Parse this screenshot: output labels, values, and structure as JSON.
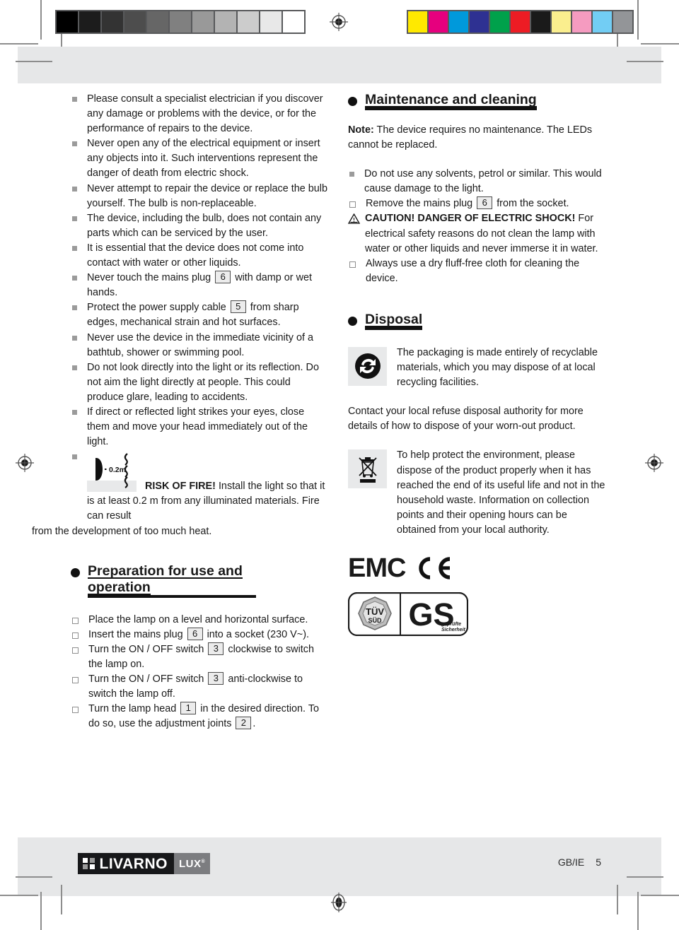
{
  "print_marks": {
    "grayscale_wedge": [
      "#000000",
      "#1c1c1c",
      "#333333",
      "#4d4d4d",
      "#666666",
      "#808080",
      "#999999",
      "#b3b3b3",
      "#cccccc",
      "#e8e8e8",
      "#ffffff"
    ],
    "color_bar": [
      "#ffe900",
      "#e6007e",
      "#0099db",
      "#2e3192",
      "#00a14b",
      "#ed1c24",
      "#1a1a1a",
      "#faee8e",
      "#f59bc0",
      "#72cdf4",
      "#939598"
    ],
    "registration_icon": "registration-target-icon"
  },
  "left_column": {
    "safety_bullets": [
      "Please consult a specialist electrician if you discover any damage or problems with the device, or for the performance of repairs to the device.",
      "Never open any of the electrical equipment or insert any objects into it. Such interventions represent the danger of death from electric shock.",
      "Never attempt to repair the device or replace the bulb yourself. The bulb is non-replaceable.",
      "The device, including the bulb, does not contain any parts which can be serviced by the user.",
      "It is essential that the device does not come into contact with water or other liquids."
    ],
    "plug_bullet": {
      "before": "Never touch the mains plug",
      "ref": "6",
      "after": "with damp or wet hands."
    },
    "cable_bullet": {
      "before": "Protect the power supply cable",
      "ref": "5",
      "after": "from sharp edges, mechanical strain and hot surfaces."
    },
    "safety_bullets_2": [
      "Never use the device in the immediate vicinity of a bathtub, shower or swimming pool.",
      "Do not look directly into the light or its reflection. Do not aim the light directly at people. This could produce glare, leading to accidents.",
      "If direct or reflected light strikes your eyes, close them and move your head immediately out of the light."
    ],
    "fire_warning": {
      "icon": "minimum-distance-0.2m-icon",
      "icon_label": "---0.2m",
      "title": "RISK OF FIRE!",
      "body": "Install the light so that it is at least 0.2 m from any illuminated materials. Fire can result",
      "tail": "from the development of too much heat."
    },
    "preparation": {
      "heading": "Preparation for use and operation",
      "steps": [
        {
          "before": "Place the lamp on a level and horizontal surface.",
          "ref": "",
          "after": ""
        },
        {
          "before": "Insert the mains plug",
          "ref": "6",
          "after": "into a socket (230 V~)."
        },
        {
          "before": "Turn the ON / OFF switch",
          "ref": "3",
          "after": "clockwise to switch the lamp on."
        },
        {
          "before": "Turn the ON / OFF switch",
          "ref": "3",
          "after": "anti-clockwise to switch the lamp off."
        },
        {
          "before": "Turn the lamp head",
          "ref": "1",
          "after": "in the desired direction."
        }
      ],
      "last_step_tail_before": "To do so, use the adjustment joints",
      "last_step_tail_ref": "2",
      "last_step_tail_after": "."
    }
  },
  "right_column": {
    "maintenance": {
      "heading": "Maintenance and cleaning",
      "note_label": "Note:",
      "note_text": "The device requires no maintenance. The LEDs cannot be replaced.",
      "bullet_solvents": "Do not use any solvents, petrol or similar. This would cause damage to the light.",
      "bullet_plug": {
        "before": "Remove the mains plug",
        "ref": "6",
        "after": "from the socket."
      },
      "caution": {
        "icon": "warning-triangle-icon",
        "title": "CAUTION! DANGER OF ELECTRIC SHOCK!",
        "body": "For electrical safety reasons do not clean the lamp with water or other liquids and never immerse it in water."
      },
      "bullet_cloth": "Always use a dry fluff-free cloth for cleaning the device."
    },
    "disposal": {
      "heading": "Disposal",
      "recycling_icon": "green-dot-recycling-icon",
      "recycling_text": "The packaging is made entirely of recyclable materials, which you may dispose of at local recycling facilities.",
      "contact_text": "Contact your local refuse disposal authority for more details of how to dispose of your worn-out product.",
      "weee_icon": "crossed-out-wheelie-bin-icon",
      "weee_text": "To help protect the environment, please dispose of the product properly when it has reached the end of its useful life and not in the household waste. Information on collection points and their opening hours can be obtained from your local authority."
    },
    "marks": {
      "emc": "EMC",
      "ce_icon": "ce-mark-icon",
      "tuv_main": "TÜV",
      "tuv_sub": "SÜD",
      "gs": "GS",
      "gs_line1": "geprüfte",
      "gs_line2": "Sicherheit"
    }
  },
  "footer": {
    "brand_main": "LIVARNO",
    "brand_sub": "LUX",
    "brand_sup": "®",
    "locale": "GB/IE",
    "page_number": "5"
  }
}
